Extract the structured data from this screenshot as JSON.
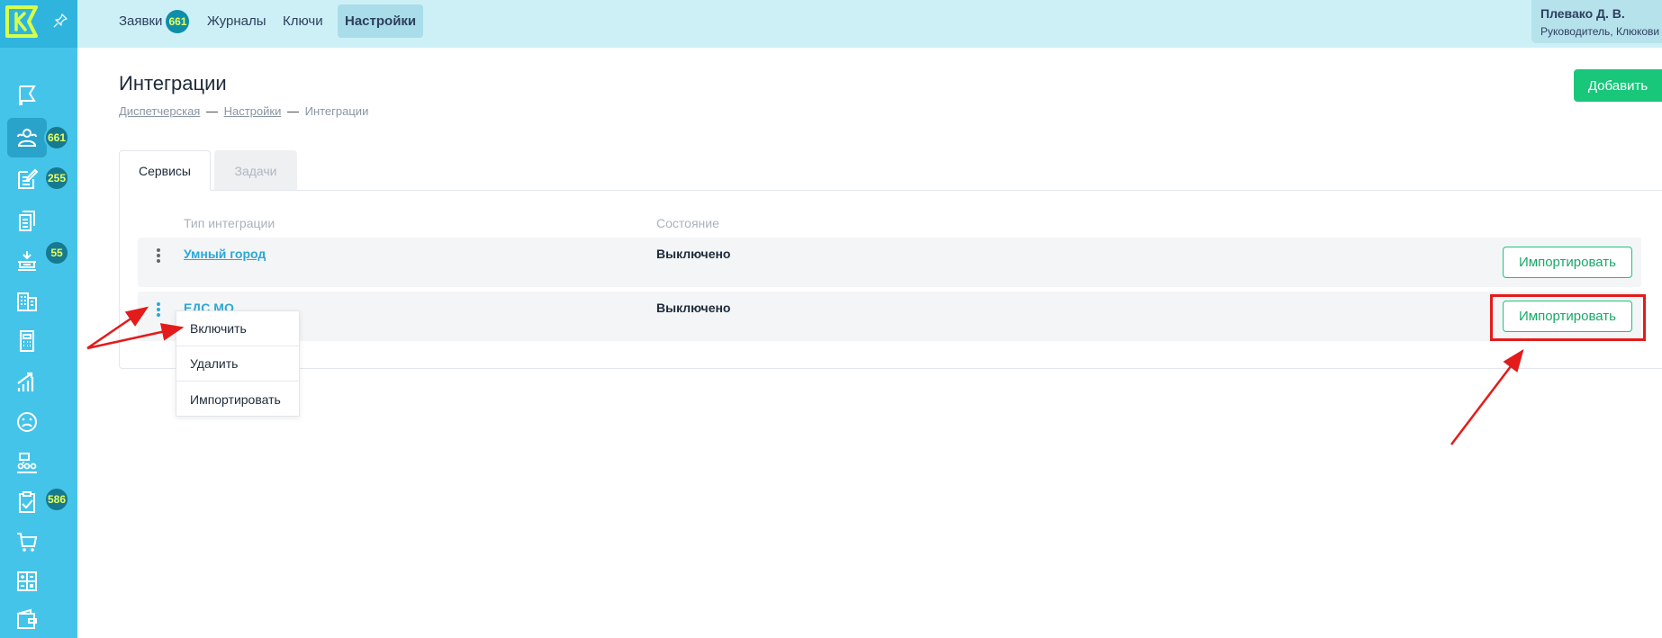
{
  "topnav": [
    {
      "label": "Заявки",
      "badge": "661"
    },
    {
      "label": "Журналы"
    },
    {
      "label": "Ключи"
    },
    {
      "label": "Настройки",
      "active": true
    }
  ],
  "user": {
    "name": "Плевако Д. В.",
    "role": "Руководитель, Клюкови"
  },
  "sidebar_badges": {
    "requests": "661",
    "journal": "255",
    "tasks": "55",
    "checklist": "586"
  },
  "page": {
    "title": "Интеграции",
    "breadcrumb": [
      "Диспетчерская",
      "Настройки",
      "Интеграции"
    ],
    "breadcrumb_sep": "—",
    "add_label": "Добавить"
  },
  "tabs": [
    {
      "label": "Сервисы",
      "active": true
    },
    {
      "label": "Задачи"
    }
  ],
  "table": {
    "columns": [
      "Тип интеграции",
      "Состояние"
    ],
    "rows": [
      {
        "name": "Умный город",
        "state": "Выключено",
        "action": "Импортировать"
      },
      {
        "name": "ЕДС МО",
        "state": "Выключено",
        "action": "Импортировать"
      }
    ]
  },
  "context_menu": [
    "Включить",
    "Удалить",
    "Импортировать"
  ],
  "colors": {
    "sidebar": "#45c4e9",
    "topbar": "#cdf0f7",
    "accent": "#19c77a",
    "link": "#2ba8d6",
    "annotation": "#e31b1b"
  }
}
